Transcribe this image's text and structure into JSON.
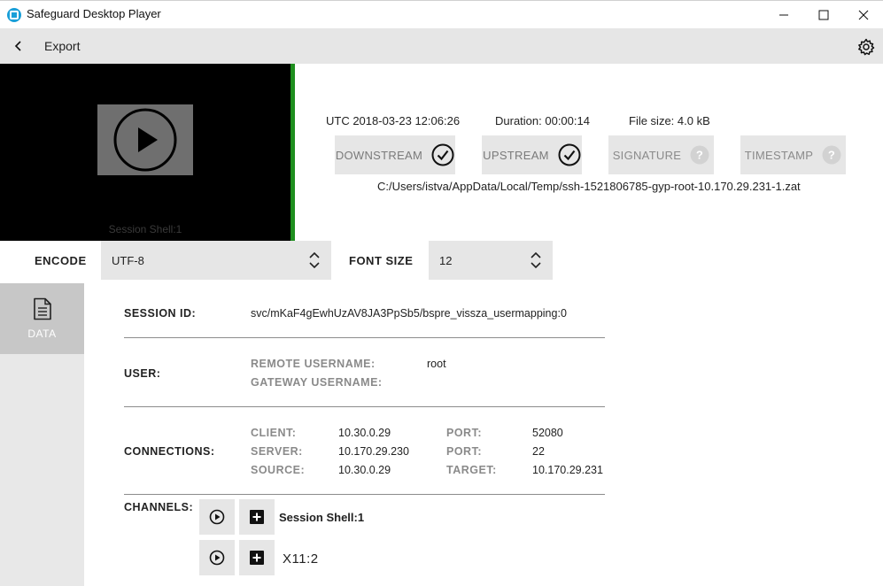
{
  "window": {
    "title": "Safeguard Desktop Player"
  },
  "toolbar": {
    "back_icon": "chevron-left-icon",
    "title": "Export",
    "settings_icon": "gear-icon"
  },
  "player": {
    "caption": "Session Shell:1",
    "play_icon": "play-circle-icon"
  },
  "info": {
    "utc": "UTC 2018-03-23 12:06:26",
    "duration": "Duration: 00:00:14",
    "file_size": "File size: 4.0 kB",
    "filepath": "C:/Users/istva/AppData/Local/Temp/ssh-1521806785-gyp-root-10.170.29.231-1.zat"
  },
  "status": [
    {
      "label": "DOWNSTREAM",
      "icon": "check-circle-icon"
    },
    {
      "label": "UPSTREAM",
      "icon": "check-circle-icon"
    },
    {
      "label": "SIGNATURE",
      "icon": "question-circle-icon"
    },
    {
      "label": "TIMESTAMP",
      "icon": "question-circle-icon"
    }
  ],
  "encode": {
    "label": "ENCODE",
    "value": "UTF-8",
    "font_size_label": "FONT SIZE",
    "font_size_value": "12"
  },
  "sidebar": {
    "data_label": "DATA",
    "data_icon": "document-icon"
  },
  "details": {
    "session_id_label": "SESSION ID:",
    "session_id": "svc/mKaF4gEwhUzAV8JA3PpSb5/bspre_vissza_usermapping:0",
    "user_label": "USER:",
    "remote_username_label": "REMOTE USERNAME:",
    "remote_username": "root",
    "gateway_username_label": "GATEWAY USERNAME:",
    "connections_label": "CONNECTIONS:",
    "client_label": "CLIENT:",
    "client": "10.30.0.29",
    "server_label": "SERVER:",
    "server": "10.170.29.230",
    "source_label": "SOURCE:",
    "source": "10.30.0.29",
    "port1_label": "PORT:",
    "port1": "52080",
    "port2_label": "PORT:",
    "port2": "22",
    "target_label": "TARGET:",
    "target": "10.170.29.231",
    "channels_label": "CHANNELS:",
    "channels": [
      {
        "name": "Session Shell:1"
      },
      {
        "name": "X11:2"
      }
    ]
  },
  "colors": {
    "accent_green": "#1f8f1f",
    "app_icon": "#1a9fd8"
  }
}
